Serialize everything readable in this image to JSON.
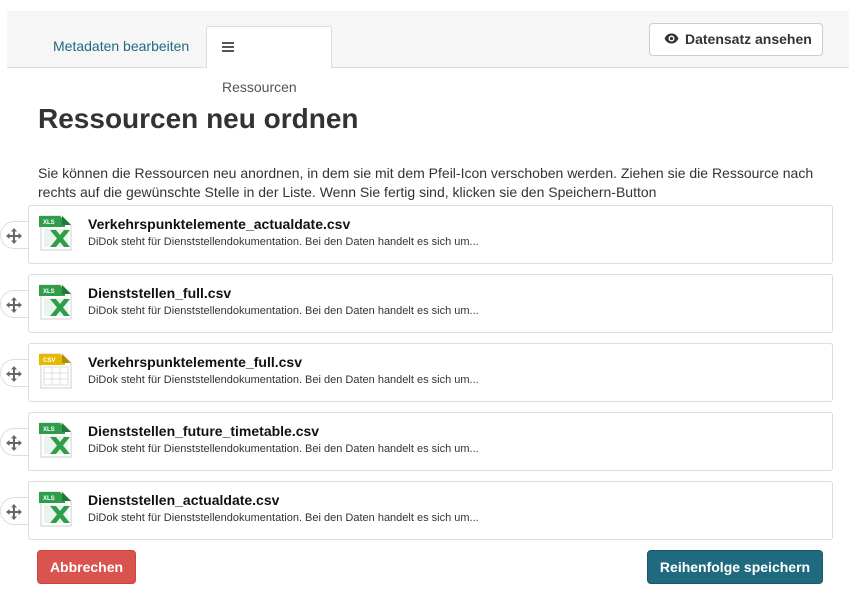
{
  "tabs": {
    "metadata_label": "Metadaten bearbeiten",
    "resources_label": "Ressourcen",
    "view_dataset_label": "Datensatz ansehen"
  },
  "page": {
    "title": "Ressourcen neu ordnen",
    "intro": "Sie können die Ressourcen neu anordnen, in dem sie mit dem Pfeil-Icon verschoben werden. Ziehen sie die Ressource nach rechts auf die gewünschte Stelle in der Liste. Wenn Sie fertig sind, klicken sie den Speichern-Button"
  },
  "resources": [
    {
      "name": "Verkehrspunktelemente_actualdate.csv",
      "description": "DiDok steht für Dienststellendokumentation. Bei den Daten handelt es sich um...",
      "format": "XLS",
      "icon": "xls-file-icon"
    },
    {
      "name": "Dienststellen_full.csv",
      "description": "DiDok steht für Dienststellendokumentation. Bei den Daten handelt es sich um...",
      "format": "XLS",
      "icon": "xls-file-icon"
    },
    {
      "name": "Verkehrspunktelemente_full.csv",
      "description": "DiDok steht für Dienststellendokumentation. Bei den Daten handelt es sich um...",
      "format": "CSV",
      "icon": "csv-file-icon"
    },
    {
      "name": "Dienststellen_future_timetable.csv",
      "description": "DiDok steht für Dienststellendokumentation. Bei den Daten handelt es sich um...",
      "format": "XLS",
      "icon": "xls-file-icon"
    },
    {
      "name": "Dienststellen_actualdate.csv",
      "description": "DiDok steht für Dienststellendokumentation. Bei den Daten handelt es sich um...",
      "format": "XLS",
      "icon": "xls-file-icon"
    }
  ],
  "actions": {
    "cancel_label": "Abbrechen",
    "save_label": "Reihenfolge speichern"
  },
  "colors": {
    "link": "#206b82",
    "cancel": "#d9534f",
    "save": "#1f6a7f",
    "xls": "#2e9e4a",
    "csv": "#e6b800"
  }
}
